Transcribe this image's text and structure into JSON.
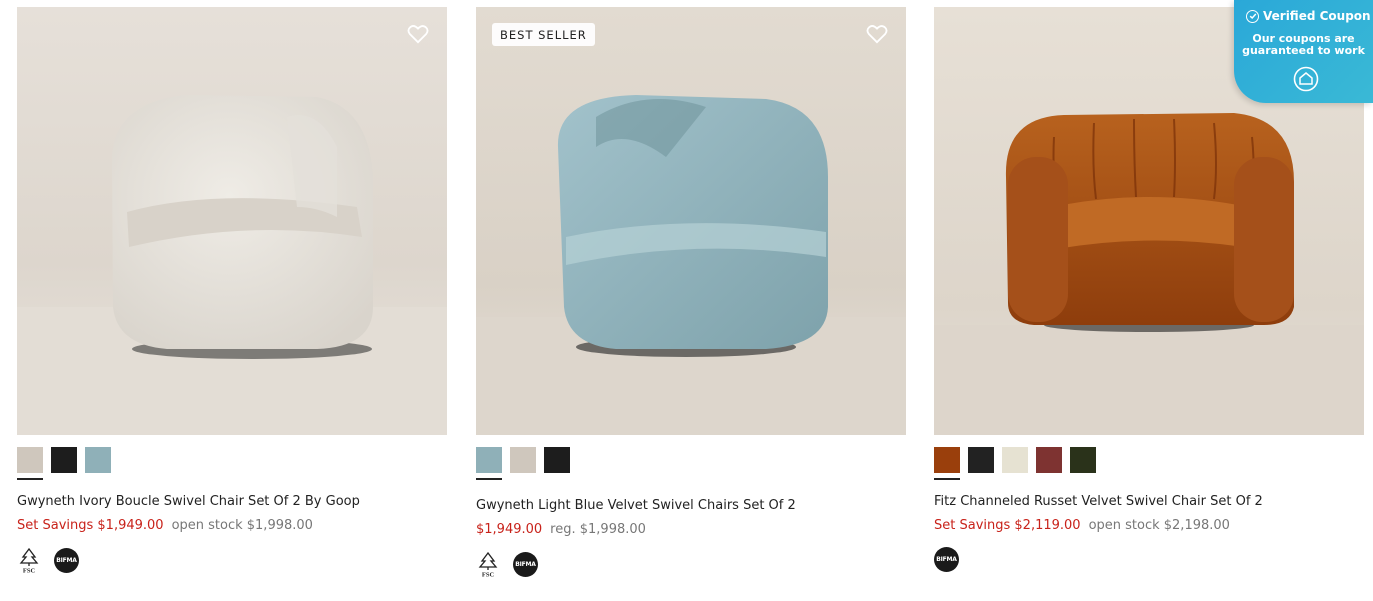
{
  "products": [
    {
      "badge": "",
      "image_desc": "ivory boucle swivel chair",
      "swatches": [
        {
          "name": "ivory",
          "color": "#cfc7bd",
          "selected": true
        },
        {
          "name": "black",
          "color": "#1d1d1d",
          "selected": false
        },
        {
          "name": "light-blue",
          "color": "#8fb0b8",
          "selected": false
        }
      ],
      "title": "Gwyneth Ivory Boucle Swivel Chair Set Of 2 By Goop",
      "price_sale": "Set Savings $1,949.00",
      "price_reg": "open stock $1,998.00",
      "certs": [
        "fsc",
        "bifma"
      ]
    },
    {
      "badge": "BEST SELLER",
      "image_desc": "light blue velvet swivel chair",
      "swatches": [
        {
          "name": "light-blue",
          "color": "#8fb0b8",
          "selected": true
        },
        {
          "name": "ivory",
          "color": "#cfc7bd",
          "selected": false
        },
        {
          "name": "black",
          "color": "#1d1d1d",
          "selected": false
        }
      ],
      "title": "Gwyneth Light Blue Velvet Swivel Chairs Set Of 2",
      "price_sale": "$1,949.00",
      "price_reg": "reg. $1,998.00",
      "certs": [
        "fsc",
        "bifma"
      ]
    },
    {
      "badge": "",
      "image_desc": "russet channeled velvet swivel chair",
      "swatches": [
        {
          "name": "russet",
          "color": "#9a3f0c",
          "selected": true
        },
        {
          "name": "black-boucle",
          "color": "#222222",
          "selected": false
        },
        {
          "name": "cream",
          "color": "#e6e2d2",
          "selected": false
        },
        {
          "name": "burgundy",
          "color": "#7e3331",
          "selected": false
        },
        {
          "name": "dark-green",
          "color": "#2a321a",
          "selected": false
        }
      ],
      "title": "Fitz Channeled Russet Velvet Swivel Chair Set Of 2",
      "price_sale": "Set Savings $2,119.00",
      "price_reg": "open stock $2,198.00",
      "certs": [
        "bifma"
      ]
    }
  ],
  "cert_labels": {
    "fsc": "FSC",
    "bifma": "BIFMA"
  },
  "coupon": {
    "title": "Verified Coupon",
    "subtitle_line1": "Our coupons are",
    "subtitle_line2": "guaranteed to work"
  },
  "colors": {
    "sale_red": "#c8221a",
    "coupon_blue": "#2aa8d8"
  }
}
